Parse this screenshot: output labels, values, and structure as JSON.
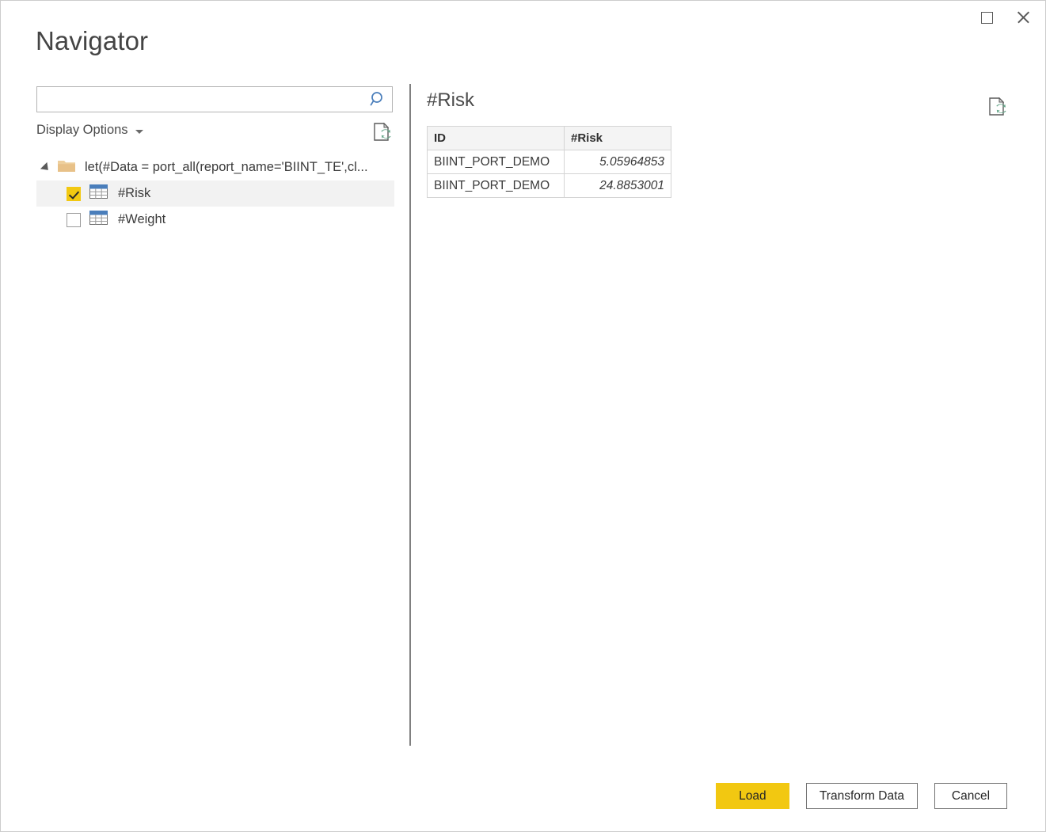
{
  "window": {
    "title": "Navigator",
    "controls": [
      {
        "name": "maximize",
        "icon": "maximize-icon"
      },
      {
        "name": "close",
        "icon": "close-icon"
      }
    ]
  },
  "search": {
    "value": "",
    "placeholder": "",
    "icon": "search-icon"
  },
  "display_options": {
    "label": "Display Options",
    "caret_icon": "chevron-down-icon",
    "refresh_icon": "refresh-document-icon"
  },
  "tree": {
    "root": {
      "label": "let(#Data = port_all(report_name='BIINT_TE',cl...",
      "icon": "folder-icon",
      "expanded": true
    },
    "items": [
      {
        "label": "#Risk",
        "checked": true,
        "selected": true,
        "icon": "table-icon"
      },
      {
        "label": "#Weight",
        "checked": false,
        "selected": false,
        "icon": "table-icon"
      }
    ]
  },
  "preview": {
    "title": "#Risk",
    "refresh_icon": "refresh-document-icon",
    "columns": [
      "ID",
      "#Risk"
    ],
    "rows": [
      [
        "BIINT_PORT_DEMO",
        "5.05964853"
      ],
      [
        "BIINT_PORT_DEMO",
        "24.8853001"
      ]
    ]
  },
  "footer": {
    "load_label": "Load",
    "transform_label": "Transform Data",
    "cancel_label": "Cancel"
  },
  "colors": {
    "accent": "#f2c811",
    "selection": "#f2f2f2",
    "divider": "#808080",
    "search_icon": "#4a7ebb",
    "folder": "#e8c188",
    "refresh_green": "#6aa88c"
  }
}
